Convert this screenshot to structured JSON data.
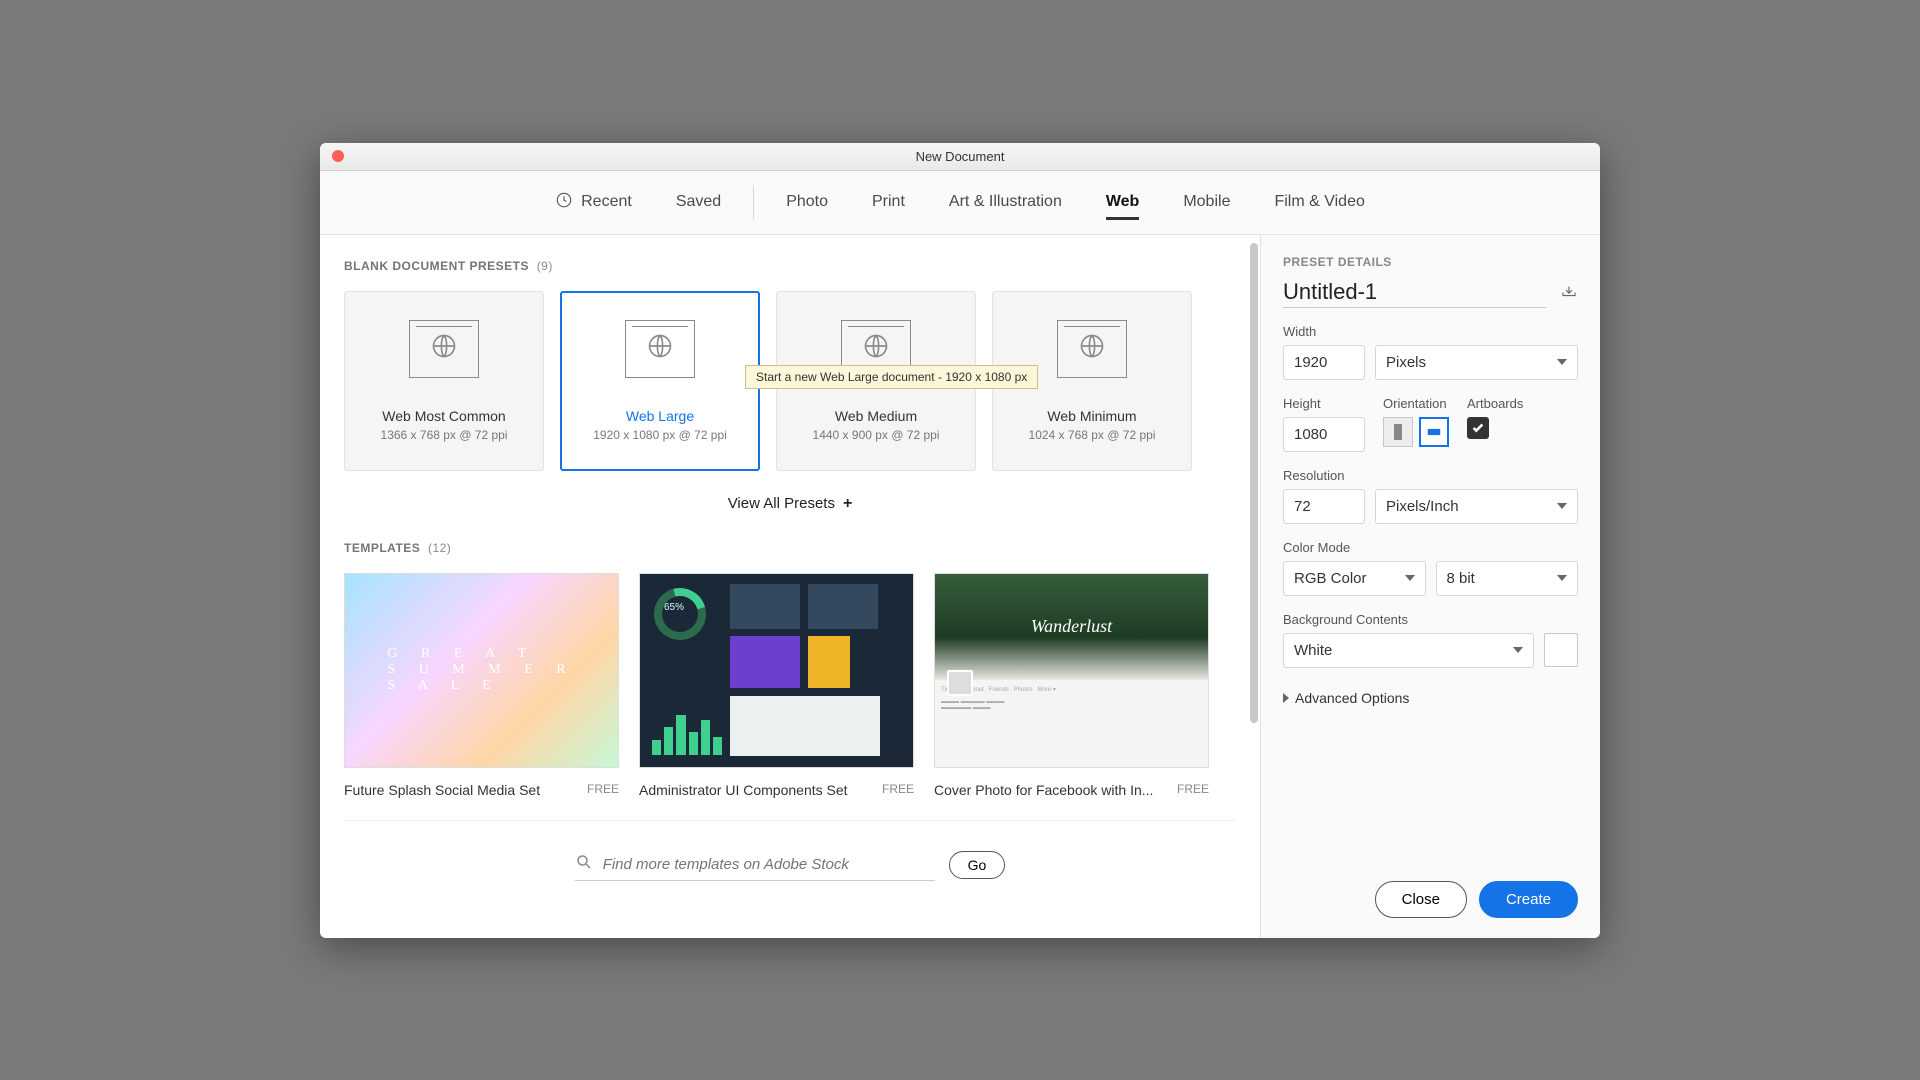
{
  "window": {
    "title": "New Document"
  },
  "tabs": {
    "recent": "Recent",
    "saved": "Saved",
    "photo": "Photo",
    "print": "Print",
    "art": "Art & Illustration",
    "web": "Web",
    "mobile": "Mobile",
    "film": "Film & Video"
  },
  "presets": {
    "heading": "BLANK DOCUMENT PRESETS",
    "count": "(9)",
    "items": [
      {
        "name": "Web Most Common",
        "dims": "1366 x 768 px @ 72 ppi"
      },
      {
        "name": "Web Large",
        "dims": "1920 x 1080 px @ 72 ppi"
      },
      {
        "name": "Web Medium",
        "dims": "1440 x 900 px @ 72 ppi"
      },
      {
        "name": "Web Minimum",
        "dims": "1024 x 768 px @ 72 ppi"
      }
    ],
    "view_all": "View All Presets",
    "tooltip": "Start a new Web Large document - 1920 x 1080 px"
  },
  "templates": {
    "heading": "TEMPLATES",
    "count": "(12)",
    "items": [
      {
        "name": "Future Splash Social Media Set",
        "badge": "FREE"
      },
      {
        "name": "Administrator UI Components Set",
        "badge": "FREE"
      },
      {
        "name": "Cover Photo for Facebook with In...",
        "badge": "FREE"
      }
    ],
    "dash_percent": "65%",
    "fb_cover_text": "Wanderlust"
  },
  "search": {
    "placeholder": "Find more templates on Adobe Stock",
    "go": "Go"
  },
  "sidebar": {
    "heading": "PRESET DETAILS",
    "doc_name": "Untitled-1",
    "width_label": "Width",
    "width_value": "1920",
    "units": "Pixels",
    "height_label": "Height",
    "height_value": "1080",
    "orientation_label": "Orientation",
    "artboards_label": "Artboards",
    "resolution_label": "Resolution",
    "resolution_value": "72",
    "resolution_units": "Pixels/Inch",
    "color_mode_label": "Color Mode",
    "color_mode_value": "RGB Color",
    "bit_depth": "8 bit",
    "bg_label": "Background Contents",
    "bg_value": "White",
    "advanced": "Advanced Options",
    "close": "Close",
    "create": "Create"
  }
}
